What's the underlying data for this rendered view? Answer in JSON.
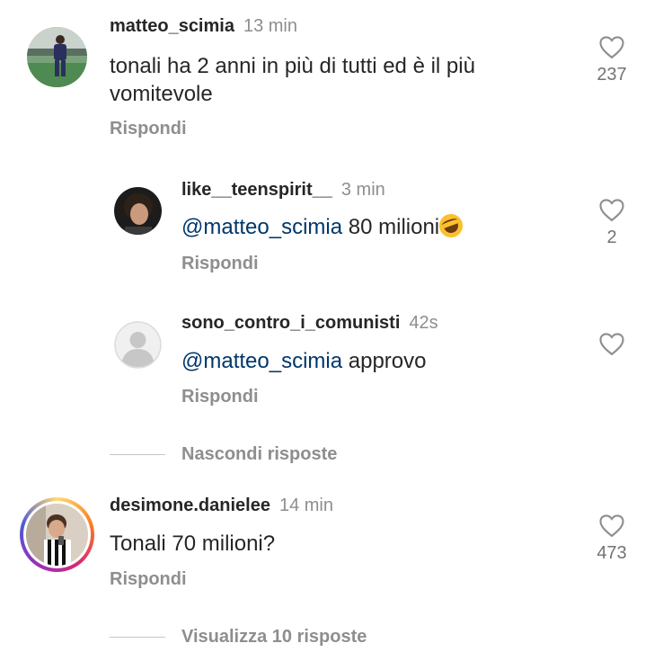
{
  "comments": [
    {
      "username": "matteo_scimia",
      "time": "13 min",
      "text": "tonali ha 2 anni in più di tutti ed è il più vomitevole",
      "reply_label": "Rispondi",
      "likes": "237"
    },
    {
      "username": "desimone.danielee",
      "time": "14 min",
      "text": "Tonali 70 milioni?",
      "reply_label": "Rispondi",
      "likes": "473"
    }
  ],
  "replies": [
    {
      "username": "like__teenspirit__",
      "time": "3 min",
      "mention": "@matteo_scimia",
      "text": " 80 milioni",
      "emoji": "rolling-on-floor-laughing",
      "reply_label": "Rispondi",
      "likes": "2"
    },
    {
      "username": "sono_contro_i_comunisti",
      "time": "42s",
      "mention": "@matteo_scimia",
      "text": " approvo",
      "reply_label": "Rispondi",
      "likes": ""
    }
  ],
  "hide_replies_label": "Nascondi risposte",
  "view_replies_label": "Visualizza 10 risposte",
  "icons": {
    "like": "heart-outline-icon",
    "default_avatar": "default-user-avatar-icon"
  },
  "colors": {
    "mention": "#00376b",
    "secondary_text": "#8e8e8e",
    "primary_text": "#262626"
  }
}
